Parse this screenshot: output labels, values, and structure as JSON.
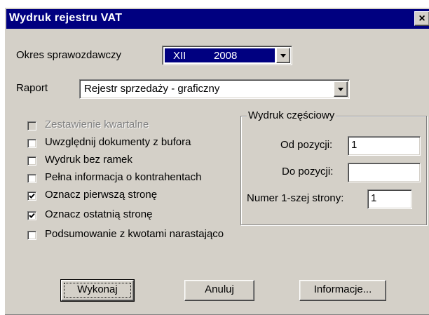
{
  "window": {
    "title": "Wydruk rejestru VAT",
    "close_glyph": "×"
  },
  "period": {
    "label": "Okres sprawozdawczy",
    "month": "XII",
    "year": "2008"
  },
  "report": {
    "label": "Raport",
    "value": "Rejestr sprzedaży - graficzny"
  },
  "options": [
    {
      "label": "Zestawienie kwartalne",
      "checked": false,
      "enabled": false
    },
    {
      "label": "Uwzględnij dokumenty z bufora",
      "checked": false,
      "enabled": true
    },
    {
      "label": "Wydruk bez ramek",
      "checked": false,
      "enabled": true
    },
    {
      "label": "Pełna informacja o kontrahentach",
      "checked": false,
      "enabled": true
    },
    {
      "label": "Oznacz pierwszą stronę",
      "checked": true,
      "enabled": true
    },
    {
      "label": "Oznacz ostatnią stronę",
      "checked": true,
      "enabled": true
    },
    {
      "label": "Podsumowanie z kwotami narastająco",
      "checked": false,
      "enabled": true
    }
  ],
  "partial": {
    "legend": "Wydruk częściowy",
    "from_label": "Od pozycji:",
    "from_value": "1",
    "to_label": "Do pozycji:",
    "to_value": "",
    "first_page_label": "Numer 1-szej strony:",
    "first_page_value": "1"
  },
  "buttons": {
    "execute": "Wykonaj",
    "cancel": "Anuluj",
    "info": "Informacje..."
  },
  "colors": {
    "titlebar": "#000080",
    "face": "#d4d0c8",
    "selection": "#000080"
  }
}
